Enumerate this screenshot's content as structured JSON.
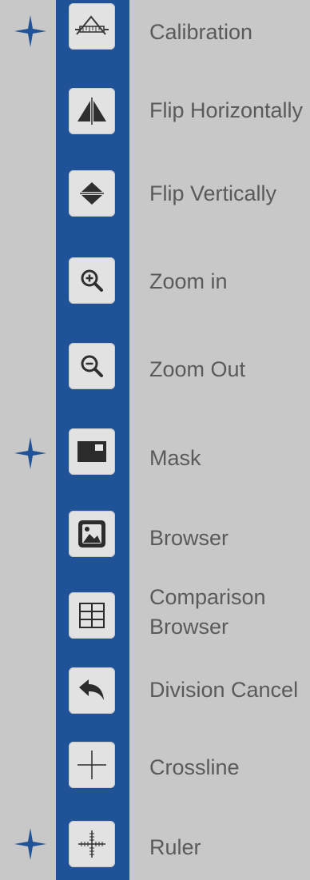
{
  "accent_color": "#1f5296",
  "tools": [
    {
      "label": "Calibration",
      "icon": "calibration-icon",
      "highlighted": true
    },
    {
      "label": "Flip Horizontally",
      "icon": "flip-horizontal-icon",
      "highlighted": false
    },
    {
      "label": "Flip Vertically",
      "icon": "flip-vertical-icon",
      "highlighted": false
    },
    {
      "label": "Zoom in",
      "icon": "zoom-in-icon",
      "highlighted": false
    },
    {
      "label": "Zoom Out",
      "icon": "zoom-out-icon",
      "highlighted": false
    },
    {
      "label": "Mask",
      "icon": "mask-icon",
      "highlighted": true
    },
    {
      "label": "Browser",
      "icon": "image-browser-icon",
      "highlighted": false
    },
    {
      "label_line1": "Comparison",
      "label_line2": "Browser",
      "icon": "comparison-grid-icon",
      "highlighted": false
    },
    {
      "label": "Division Cancel",
      "icon": "undo-arrow-icon",
      "highlighted": false
    },
    {
      "label": "Crossline",
      "icon": "crossline-icon",
      "highlighted": false
    },
    {
      "label": "Ruler",
      "icon": "ruler-icon",
      "highlighted": true
    }
  ]
}
